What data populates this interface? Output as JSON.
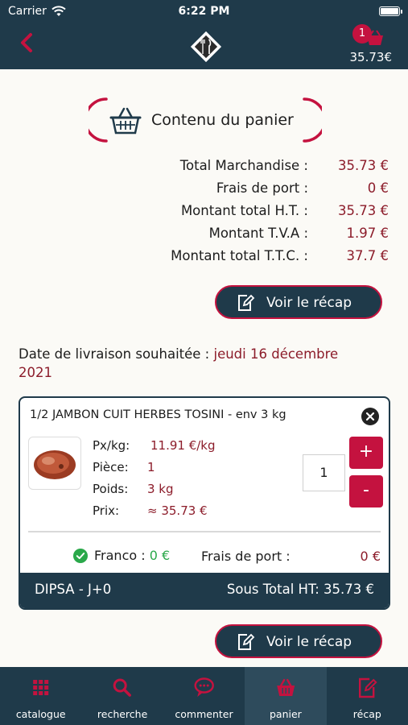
{
  "status_bar": {
    "carrier": "Carrier",
    "time": "6:22 PM"
  },
  "header": {
    "cart_badge": "1",
    "cart_amount": "35.73€"
  },
  "title": "Contenu du panier",
  "totals": [
    {
      "label": "Total Marchandise :",
      "value": "35.73 €"
    },
    {
      "label": "Frais de port :",
      "value": "0 €"
    },
    {
      "label": "Montant total H.T. :",
      "value": "35.73 €"
    },
    {
      "label": "Montant T.V.A :",
      "value": "1.97 €"
    },
    {
      "label": "Montant total T.T.C. :",
      "value": "37.7 €"
    }
  ],
  "recap_button_label": "Voir le récap",
  "delivery": {
    "label": "Date de livraison souhaitée : ",
    "value": "jeudi 16 décembre 2021"
  },
  "product": {
    "name": "1/2 JAMBON CUIT HERBES TOSINI - env 3 kg",
    "props": [
      {
        "label": "Px/kg:",
        "value": "11.91 €/kg"
      },
      {
        "label": "Pièce:",
        "value": "1"
      },
      {
        "label": "Poids:",
        "value": "3 kg"
      },
      {
        "label": "Prix:",
        "value": "≈ 35.73 €"
      }
    ],
    "quantity": "1",
    "plus": "+",
    "minus": "-",
    "franco_label": "Franco : ",
    "franco_value": "0 €",
    "shipping_label": "Frais de port :",
    "shipping_value": "0 €",
    "supplier": "DIPSA - J+0",
    "subtotal": "Sous Total HT: 35.73 €"
  },
  "tabs": [
    {
      "label": "catalogue",
      "icon": "grid-icon"
    },
    {
      "label": "recherche",
      "icon": "search-icon"
    },
    {
      "label": "commenter",
      "icon": "chat-icon"
    },
    {
      "label": "panier",
      "icon": "basket-icon",
      "active": true
    },
    {
      "label": "récap",
      "icon": "edit-icon"
    }
  ],
  "colors": {
    "navy": "#1f3a4a",
    "accent": "#c4123f",
    "price": "#8c1c2a",
    "green": "#2aa84a"
  }
}
